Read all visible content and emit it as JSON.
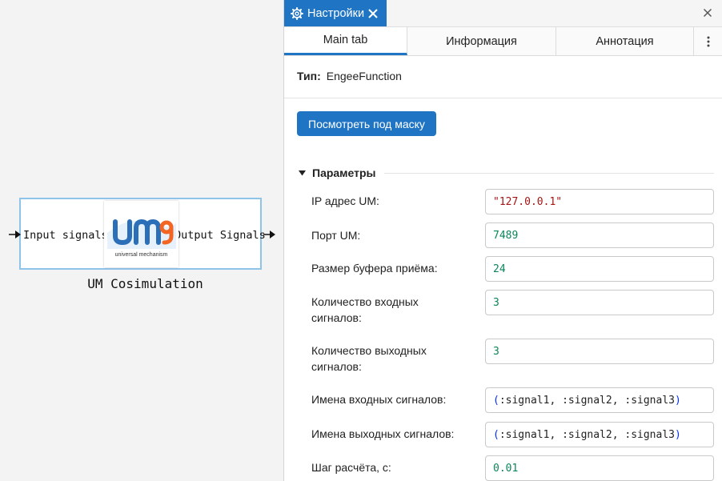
{
  "canvas": {
    "block": {
      "input_label": "Input signals",
      "output_label": "Output Signals",
      "title": "UM Cosimulation",
      "logo_text": "universal mechanism"
    }
  },
  "panel": {
    "header": {
      "tab_title": "Настройки",
      "icon": "gear-icon"
    },
    "tabs": [
      {
        "label": "Main tab",
        "active": true
      },
      {
        "label": "Информация",
        "active": false
      },
      {
        "label": "Аннотация",
        "active": false
      }
    ],
    "type_label": "Тип:",
    "type_value": "EngeeFunction",
    "mask_button": "Посмотреть под маску",
    "section_title": "Параметры",
    "params": [
      {
        "label": "IP адрес UM:",
        "value": "\"127.0.0.1\""
      },
      {
        "label": "Порт UM:",
        "value": "7489"
      },
      {
        "label": "Размер буфера приёма:",
        "value": "24"
      },
      {
        "label": "Количество входных сигналов:",
        "value": "3"
      },
      {
        "label": "Количество выходных сигналов:",
        "value": "3"
      },
      {
        "label": "Имена входных сигналов:",
        "value_open": "(",
        "value_body": ":signal1, :signal2, :signal3",
        "value_close": ")"
      },
      {
        "label": "Имена выходных сигналов:",
        "value_open": "(",
        "value_body": ":signal1, :signal2, :signal3",
        "value_close": ")"
      },
      {
        "label": "Шаг расчёта, с:",
        "value": "0.01"
      }
    ]
  },
  "colors": {
    "accent": "#1f74c4",
    "string": "#a31515",
    "number": "#098658",
    "paren": "#0431fa"
  }
}
